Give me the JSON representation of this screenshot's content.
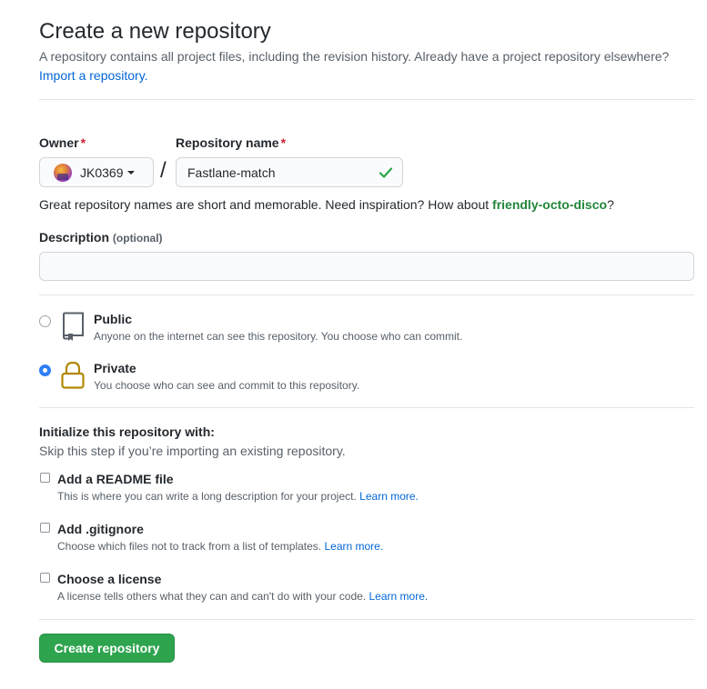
{
  "header": {
    "title": "Create a new repository",
    "subtitle": "A repository contains all project files, including the revision history. Already have a project repository elsewhere?",
    "import_link": "Import a repository."
  },
  "owner": {
    "label": "Owner",
    "required_mark": "*",
    "value": "JK0369"
  },
  "repo_name": {
    "label": "Repository name",
    "required_mark": "*",
    "value": "Fastlane-match",
    "valid": true
  },
  "separator": "/",
  "name_hint": {
    "text": "Great repository names are short and memorable. Need inspiration? How about",
    "suggestion": "friendly-octo-disco",
    "end": "?"
  },
  "description": {
    "label": "Description",
    "optional": "(optional)",
    "value": ""
  },
  "visibility": {
    "selected": "private",
    "options": [
      {
        "id": "public",
        "title": "Public",
        "desc": "Anyone on the internet can see this repository. You choose who can commit.",
        "icon": "repo-icon"
      },
      {
        "id": "private",
        "title": "Private",
        "desc": "You choose who can see and commit to this repository.",
        "icon": "lock-icon"
      }
    ]
  },
  "initialize": {
    "title": "Initialize this repository with:",
    "subtitle": "Skip this step if you’re importing an existing repository.",
    "options": [
      {
        "title": "Add a README file",
        "desc": "This is where you can write a long description for your project.",
        "link": "Learn more.",
        "checked": false
      },
      {
        "title": "Add .gitignore",
        "desc": "Choose which files not to track from a list of templates.",
        "link": "Learn more.",
        "checked": false
      },
      {
        "title": "Choose a license",
        "desc": "A license tells others what they can and can't do with your code.",
        "link": "Learn more.",
        "checked": false
      }
    ]
  },
  "submit": {
    "label": "Create repository"
  },
  "colors": {
    "link": "#0366d6",
    "suggestion": "#22863a",
    "required": "#cb2431",
    "primary_button": "#2ea44f",
    "radio_selected": "#2f7ef7",
    "lock_icon": "#b08800"
  }
}
